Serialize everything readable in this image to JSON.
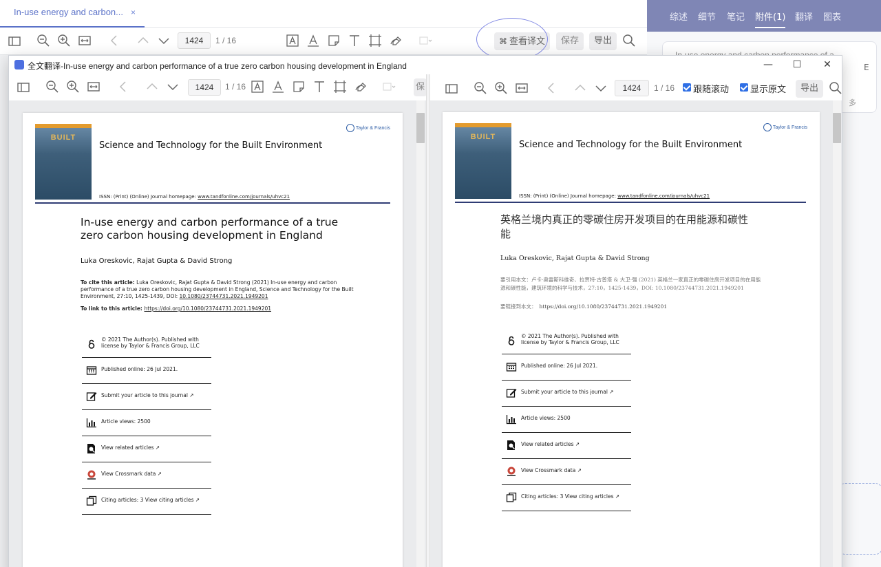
{
  "main": {
    "tab_title": "In-use energy and carbon...",
    "tab_close": "×",
    "page_input": "1424",
    "page_count": "1 / 16",
    "view_translation_label": "查看译文",
    "save_label": "保存",
    "export_label": "导出"
  },
  "right_panel": {
    "tabs": [
      "综述",
      "细节",
      "笔记",
      "附件(1)",
      "翻译",
      "图表"
    ],
    "active_tab": "附件(1)",
    "card_text": "In-use energy and carbon performance of a",
    "card_suffix": "E",
    "more_label": "多"
  },
  "translate_window": {
    "title": "全文翻译-In-use energy and carbon performance of a true zero carbon housing development in England",
    "left_toolbar": {
      "page_input": "1424",
      "page_count": "1 / 16",
      "save_label": "保"
    },
    "right_toolbar": {
      "page_input": "1424",
      "page_count": "1 / 16",
      "follow_scroll_label": "跟随滚动",
      "show_original_label": "显示原文",
      "export_label": "导出"
    }
  },
  "original_doc": {
    "journal_title": "Science and Technology for the Built Environment",
    "issn_prefix": "ISSN: (Print) (Online) Journal homepage: ",
    "issn_url": "www.tandfonline.com/journals/uhvc21",
    "publisher": "Taylor & Francis",
    "cover_text": "BUILT",
    "title": "In-use energy and carbon performance of a true zero carbon housing development in England",
    "authors": "Luka Oreskovic, Rajat Gupta & David Strong",
    "cite_label": "To cite this article:",
    "cite_text": " Luka Oreskovic, Rajat Gupta & David Strong (2021) In-use energy and carbon performance of a true zero carbon housing development in England, Science and Technology for the Built Environment, 27:10, 1425-1439, DOI: ",
    "cite_doi": "10.1080/23744731.2021.1949201",
    "link_label": "To link to this article: ",
    "link_url": "https://doi.org/10.1080/23744731.2021.1949201",
    "info": [
      {
        "icon": "open-access-icon",
        "text": "© 2021 The Author(s). Published with",
        "text2": "license by Taylor & Francis Group, LLC"
      },
      {
        "icon": "calendar-icon",
        "text": "Published online: 26 Jul 2021."
      },
      {
        "icon": "edit-icon",
        "text": "Submit your article to this journal ↗"
      },
      {
        "icon": "bar-chart-icon",
        "text": "Article views: 2500"
      },
      {
        "icon": "search-doc-icon",
        "text": "View related articles ↗"
      },
      {
        "icon": "crossmark-icon",
        "text": "View Crossmark data ↗"
      },
      {
        "icon": "citing-icon",
        "text": "Citing articles: 3 View citing articles ↗"
      }
    ]
  },
  "translated_doc": {
    "journal_title": "Science and Technology for the Built Environment",
    "issn_prefix": "ISSN: (Print) (Online) Journal homepage: ",
    "issn_url": "www.tandfonline.com/journals/uhvc21",
    "publisher": "Taylor & Francis",
    "cover_text": "BUILT",
    "title": "英格兰境内真正的零碳住房开发项目的在用能源和碳性能",
    "authors": "Luka Oreskovic, Rajat Gupta & David Strong",
    "cite_text": "要引用本文：卢卡·奥雷斯科维奇、拉贾特·古普塔 & 大卫·强 (2021) 英格兰一家真正的零碳住房开发项目的在用能源和碳性能，建筑环境的科学与技术，27:10，1425-1439，DOI: 10.1080/23744731.2021.1949201",
    "link_text": "要链接到本文：",
    "link_url": "https://doi.org/10.1080/23744731.2021.1949201",
    "info": [
      {
        "icon": "open-access-icon",
        "text": "© 2021 The Author(s). Published with",
        "text2": "license by Taylor & Francis Group, LLC"
      },
      {
        "icon": "calendar-icon",
        "text": "Published online: 26 Jul 2021."
      },
      {
        "icon": "edit-icon",
        "text": "Submit your article to this journal ↗"
      },
      {
        "icon": "bar-chart-icon",
        "text": "Article views: 2500"
      },
      {
        "icon": "search-doc-icon",
        "text": "View related articles ↗"
      },
      {
        "icon": "crossmark-icon",
        "text": "View Crossmark data ↗"
      },
      {
        "icon": "citing-icon",
        "text": "Citing articles: 3 View citing articles ↗"
      }
    ]
  },
  "colors": {
    "accent": "#5b72c8",
    "right_tab_bg": "#7f86b5",
    "checkbox": "#2f6fe5",
    "navy_rule": "#2f3c74"
  }
}
